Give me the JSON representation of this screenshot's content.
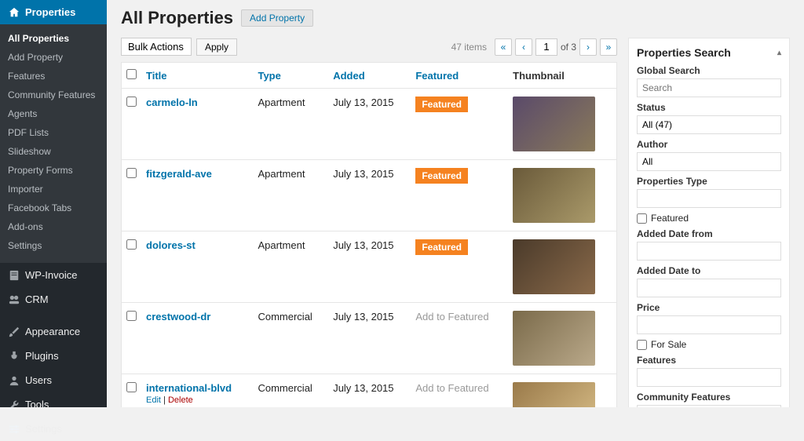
{
  "sidebar": {
    "current": {
      "label": "Properties"
    },
    "submenu": [
      "All Properties",
      "Add Property",
      "Features",
      "Community Features",
      "Agents",
      "PDF Lists",
      "Slideshow",
      "Property Forms",
      "Importer",
      "Facebook Tabs",
      "Add-ons",
      "Settings"
    ],
    "main": [
      {
        "label": "WP-Invoice",
        "icon": "invoice"
      },
      {
        "label": "CRM",
        "icon": "crm"
      },
      {
        "label": "Appearance",
        "icon": "brush"
      },
      {
        "label": "Plugins",
        "icon": "plug"
      },
      {
        "label": "Users",
        "icon": "user"
      },
      {
        "label": "Tools",
        "icon": "wrench"
      },
      {
        "label": "Settings",
        "icon": "sliders"
      }
    ]
  },
  "page": {
    "title": "All Properties",
    "add_button": "Add Property",
    "bulk_label": "Bulk Actions",
    "apply_label": "Apply",
    "item_count": "47 items",
    "page_current": "1",
    "page_total": "of 3"
  },
  "table": {
    "headers": {
      "title": "Title",
      "type": "Type",
      "added": "Added",
      "featured": "Featured",
      "thumb": "Thumbnail"
    },
    "badge_label": "Featured",
    "add_featured_label": "Add to Featured",
    "row_action_edit": "Edit",
    "row_action_delete": "Delete",
    "rows": [
      {
        "title": "carmelo-ln",
        "type": "Apartment",
        "added": "July 13, 2015",
        "featured": true,
        "thumb_class": "th1",
        "show_actions": false
      },
      {
        "title": "fitzgerald-ave",
        "type": "Apartment",
        "added": "July 13, 2015",
        "featured": true,
        "thumb_class": "th2",
        "show_actions": false
      },
      {
        "title": "dolores-st",
        "type": "Apartment",
        "added": "July 13, 2015",
        "featured": true,
        "thumb_class": "th3",
        "show_actions": false
      },
      {
        "title": "crestwood-dr",
        "type": "Commercial",
        "added": "July 13, 2015",
        "featured": false,
        "thumb_class": "th4",
        "show_actions": false
      },
      {
        "title": "international-blvd",
        "type": "Commercial",
        "added": "July 13, 2015",
        "featured": false,
        "thumb_class": "th5",
        "show_actions": true
      }
    ]
  },
  "search": {
    "title": "Properties Search",
    "global_label": "Global Search",
    "global_placeholder": "Search",
    "status_label": "Status",
    "status_value": "All (47)",
    "author_label": "Author",
    "author_value": "All",
    "type_label": "Properties Type",
    "featured_label": "Featured",
    "date_from_label": "Added Date from",
    "date_to_label": "Added Date to",
    "price_label": "Price",
    "for_sale_label": "For Sale",
    "features_label": "Features",
    "community_label": "Community Features"
  }
}
